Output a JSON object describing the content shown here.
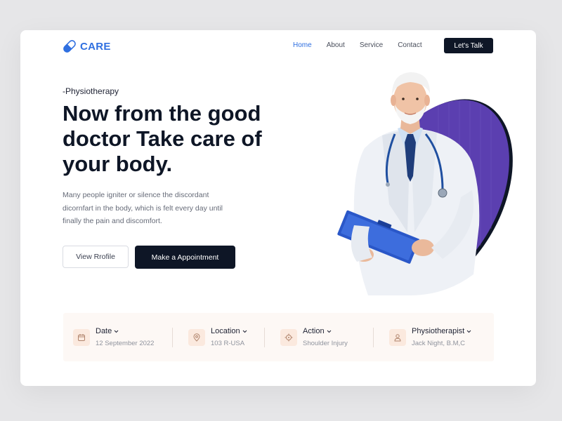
{
  "brand": {
    "name": "CARE",
    "accent": "#2f6fe0"
  },
  "nav": {
    "items": [
      {
        "label": "Home",
        "active": true
      },
      {
        "label": "About",
        "active": false
      },
      {
        "label": "Service",
        "active": false
      },
      {
        "label": "Contact",
        "active": false
      }
    ],
    "cta_label": "Let's Talk"
  },
  "hero": {
    "eyebrow": "-Physiotherapy",
    "headline": "Now from the good doctor Take care of your body.",
    "description": "Many people igniter or silence the discordant dicornfart in the body, which is felt every day until finally the pain and discomfort.",
    "secondary_button": "View Rrofile",
    "primary_button": "Make a Appointment"
  },
  "info_bar": {
    "items": [
      {
        "title": "Date",
        "value": "12 September 2022",
        "icon": "calendar-icon"
      },
      {
        "title": "Location",
        "value": "103 R-USA",
        "icon": "location-pin-icon"
      },
      {
        "title": "Action",
        "value": "Shoulder Injury",
        "icon": "crosshair-icon"
      },
      {
        "title": "Physiotherapist",
        "value": "Jack Night, B.M,C",
        "icon": "user-icon"
      }
    ]
  },
  "colors": {
    "dark": "#0e1626",
    "purple": "#5b3fb0",
    "info_bg": "#fdf8f5",
    "icon_bg": "#fbe9de",
    "icon_stroke": "#b0846c"
  }
}
